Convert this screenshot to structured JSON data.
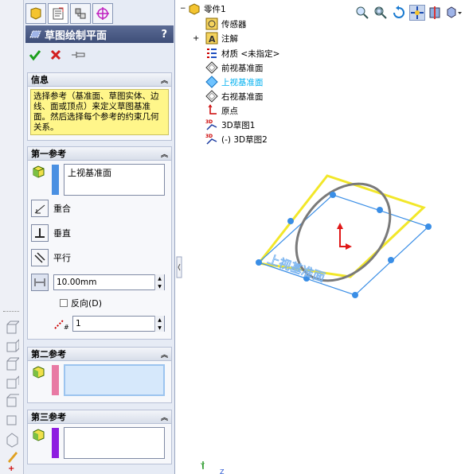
{
  "property_manager": {
    "title": "草图绘制平面",
    "help": "?",
    "info_group": {
      "title": "信息",
      "message": "选择参考（基准面、草图实体、边线、面或顶点）来定义草图基准面。然后选择每个参考的约束几何关系。"
    },
    "first_ref": {
      "title": "第一参考",
      "selection": "上视基准面",
      "constraints": [
        "重合",
        "垂直",
        "平行"
      ],
      "distance_value": "10.00mm",
      "flip_label": "反向(D)",
      "count_value": "1"
    },
    "second_ref": {
      "title": "第二参考",
      "selection": ""
    },
    "third_ref": {
      "title": "第三参考",
      "selection": ""
    }
  },
  "tree": {
    "items": [
      {
        "label": "零件1"
      },
      {
        "label": "传感器"
      },
      {
        "label": "注解"
      },
      {
        "label": "材质 <未指定>"
      },
      {
        "label": "前视基准面"
      },
      {
        "label": "上视基准面"
      },
      {
        "label": "右视基准面"
      },
      {
        "label": "原点"
      },
      {
        "label": "3D草图1"
      },
      {
        "label": "(-) 3D草图2"
      }
    ],
    "selected_color": "#00b0f0"
  },
  "viewport": {
    "plane_label": "上视基准面",
    "axis_y": "Y",
    "axis_z": "Z"
  },
  "colors": {
    "accent": "#3e4e78",
    "yellow_plane": "#f2e72a",
    "blue_plane": "#3a8ee6",
    "ellipse": "#7a7a7a",
    "first_ref_bar": "#4a90e2",
    "second_ref_bar": "#e879a4",
    "third_ref_bar": "#8e1de0"
  }
}
